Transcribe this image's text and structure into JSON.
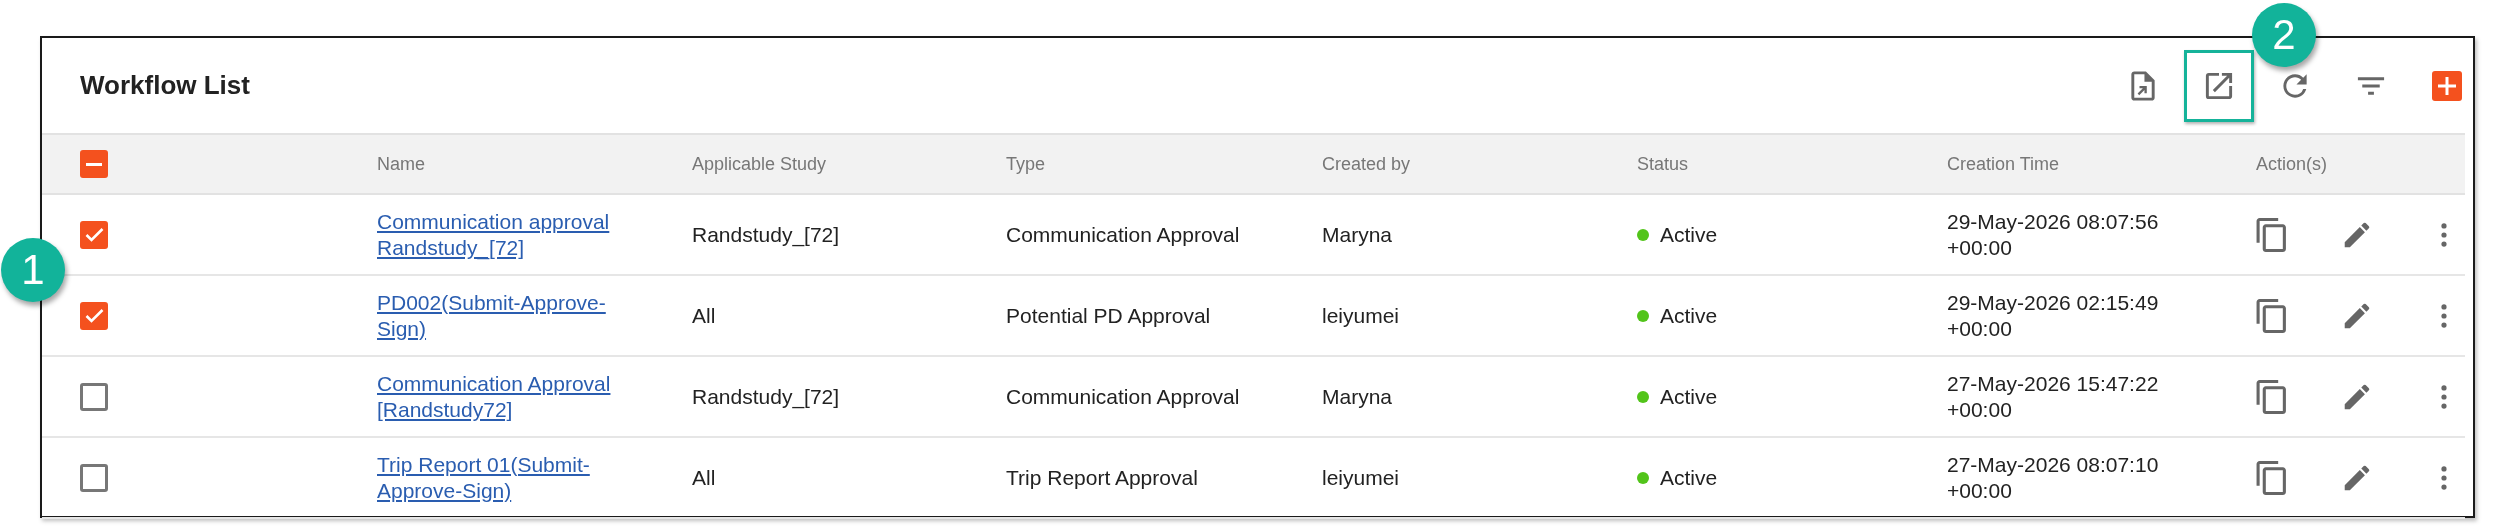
{
  "panel": {
    "title": "Workflow List"
  },
  "toolbar": [
    {
      "kind": "export-file",
      "highlighted": false
    },
    {
      "kind": "open-external",
      "highlighted": true,
      "callout": "2"
    },
    {
      "kind": "refresh",
      "highlighted": false
    },
    {
      "kind": "filter",
      "highlighted": false
    },
    {
      "kind": "add",
      "highlighted": false
    }
  ],
  "table": {
    "callout": "1",
    "select_all": {
      "indeterminate": true
    },
    "columns": [
      "Name",
      "Applicable Study",
      "Type",
      "Created by",
      "Status",
      "Creation Time",
      "Action(s)"
    ],
    "rows": [
      {
        "checked": true,
        "name": "Communication approval Randstudy_[72]",
        "study": "Randstudy_[72]",
        "type": "Communication Approval",
        "created_by": "Maryna",
        "status": {
          "label": "Active",
          "color": "#52c41a"
        },
        "creation_time": "29-May-2026 08:07:56 +00:00",
        "actions": [
          {
            "kind": "copy"
          },
          {
            "kind": "edit"
          },
          {
            "kind": "more"
          }
        ]
      },
      {
        "checked": true,
        "name": "PD002(Submit-Approve-Sign)",
        "study": "All",
        "type": "Potential PD Approval",
        "created_by": "leiyumei",
        "status": {
          "label": "Active",
          "color": "#52c41a"
        },
        "creation_time": "29-May-2026 02:15:49 +00:00",
        "actions": [
          {
            "kind": "copy"
          },
          {
            "kind": "edit"
          },
          {
            "kind": "more"
          }
        ]
      },
      {
        "checked": false,
        "name": "Communication Approval [Randstudy72]",
        "study": "Randstudy_[72]",
        "type": "Communication Approval",
        "created_by": "Maryna",
        "status": {
          "label": "Active",
          "color": "#52c41a"
        },
        "creation_time": "27-May-2026 15:47:22 +00:00",
        "actions": [
          {
            "kind": "copy"
          },
          {
            "kind": "edit"
          },
          {
            "kind": "more"
          }
        ]
      },
      {
        "checked": false,
        "name": "Trip Report 01(Submit-Approve-Sign)",
        "study": "All",
        "type": "Trip Report Approval",
        "created_by": "leiyumei",
        "status": {
          "label": "Active",
          "color": "#52c41a"
        },
        "creation_time": "27-May-2026 08:07:10 +00:00",
        "actions": [
          {
            "kind": "copy"
          },
          {
            "kind": "edit"
          },
          {
            "kind": "more"
          }
        ]
      }
    ]
  }
}
